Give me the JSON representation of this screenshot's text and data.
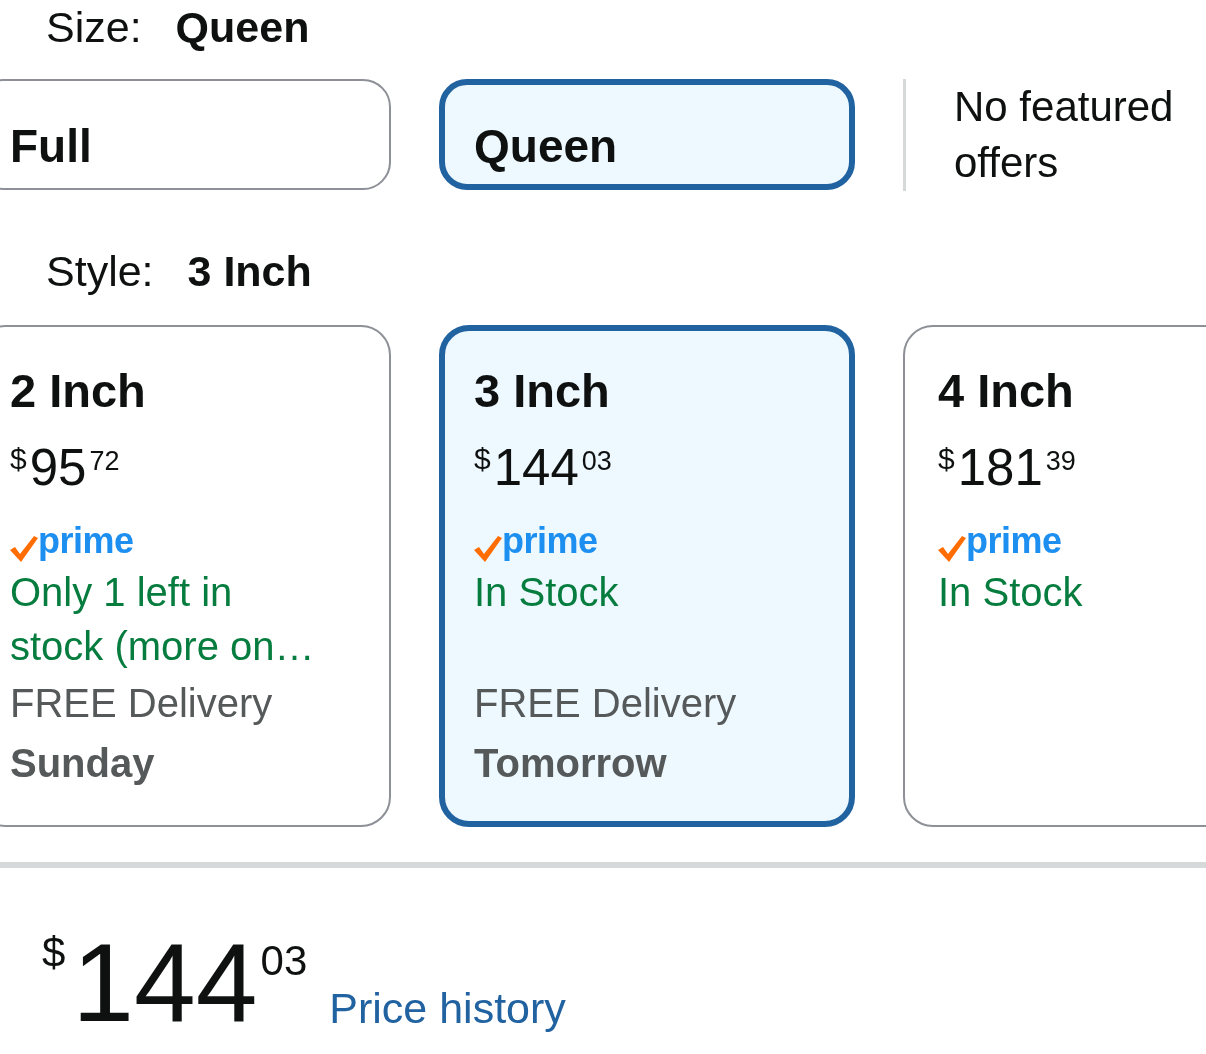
{
  "size": {
    "label": "Size:",
    "value": "Queen",
    "options": [
      {
        "label": "Full",
        "selected": false
      },
      {
        "label": "Queen",
        "selected": true
      }
    ],
    "note": "No featured offers"
  },
  "style": {
    "label": "Style:",
    "value": "3 Inch",
    "options": [
      {
        "title": "2 Inch",
        "price": {
          "symbol": "$",
          "whole": "95",
          "fraction": "72"
        },
        "badge": "prime",
        "stock": "Only 1 left in stock (more on…",
        "delivery": {
          "label": "FREE Delivery",
          "day": "Sunday"
        },
        "selected": false
      },
      {
        "title": "3 Inch",
        "price": {
          "symbol": "$",
          "whole": "144",
          "fraction": "03"
        },
        "badge": "prime",
        "stock": "In Stock",
        "delivery": {
          "label": "FREE Delivery",
          "day": "Tomorrow"
        },
        "selected": true
      },
      {
        "title": "4 Inch",
        "price": {
          "symbol": "$",
          "whole": "181",
          "fraction": "39"
        },
        "badge": "prime",
        "stock": "In Stock",
        "selected": false
      }
    ]
  },
  "price": {
    "symbol": "$",
    "whole": "144",
    "fraction": "03"
  },
  "price_history_link": "Price history"
}
